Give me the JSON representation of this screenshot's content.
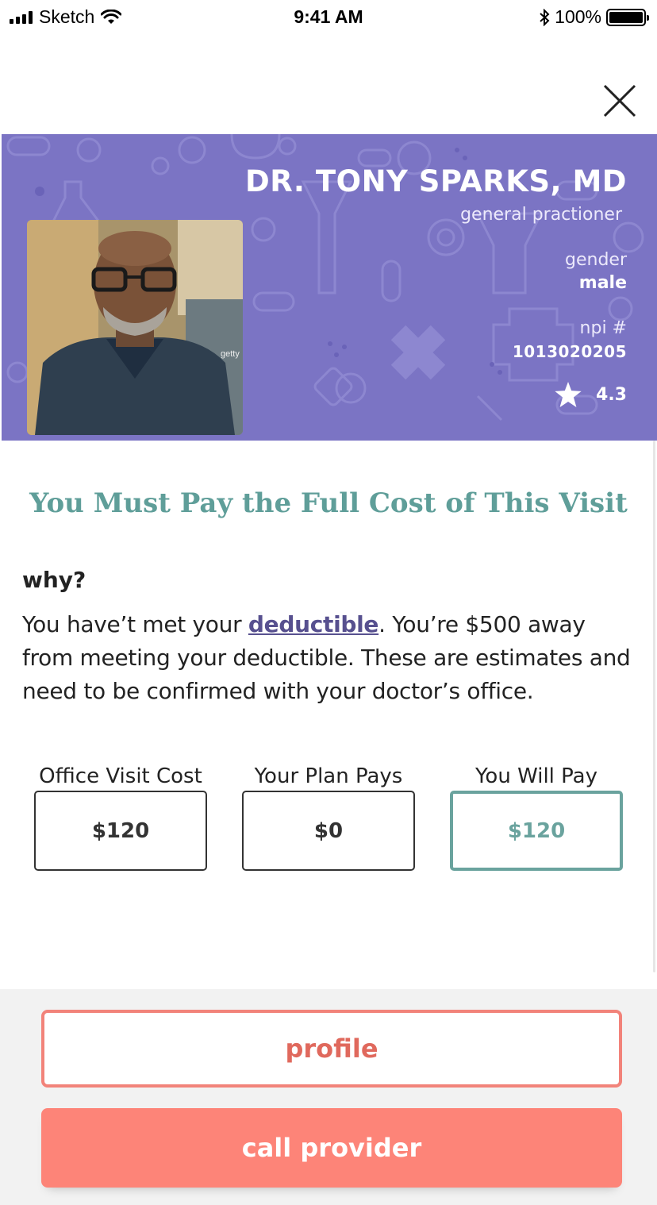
{
  "status_bar": {
    "carrier": "Sketch",
    "time": "9:41 AM",
    "battery": "100%"
  },
  "doctor": {
    "name": "DR. TONY SPARKS, MD",
    "specialty": "general practioner",
    "gender_label": "gender",
    "gender": "male",
    "npi_label": "npi #",
    "npi": "1013020205",
    "rating": "4.3"
  },
  "main": {
    "heading": "You Must Pay the Full Cost of This Visit",
    "why_label": "why?",
    "explanation_before": "You have’t met your ",
    "explanation_link": "deductible",
    "explanation_after": ". You’re $500 away from meeting your deductible. These are estimates and need to be confirmed with your doctor’s office."
  },
  "costs": [
    {
      "label": "Office Visit Cost",
      "value": "$120"
    },
    {
      "label": "Your Plan Pays",
      "value": "$0"
    },
    {
      "label": "You Will Pay",
      "value": "$120"
    }
  ],
  "actions": {
    "profile_label": "profile",
    "call_label": "call provider"
  },
  "colors": {
    "hero_bg": "#7b74c4",
    "heading": "#5f9e99",
    "link": "#57508f",
    "profile": "#f2837a",
    "call": "#fd8478"
  },
  "icons": [
    "signal-icon",
    "wifi-icon",
    "bluetooth-icon",
    "battery-icon",
    "close-icon",
    "star-icon"
  ],
  "photo_watermark": "getty"
}
